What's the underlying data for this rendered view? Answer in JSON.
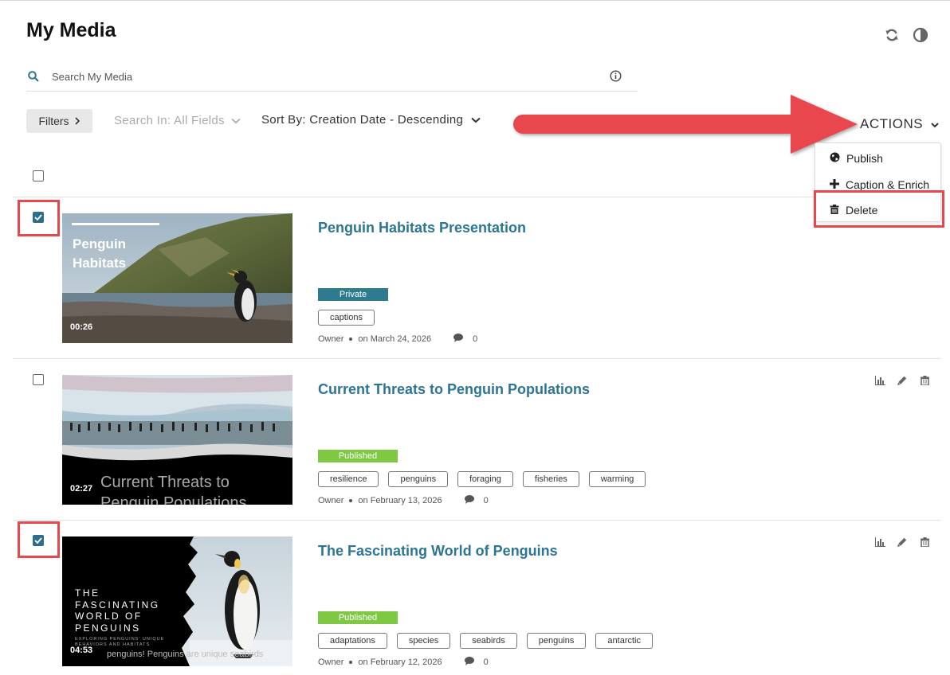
{
  "page": {
    "title": "My Media"
  },
  "search": {
    "placeholder": "Search My Media"
  },
  "toolbar": {
    "filters_label": "Filters",
    "search_in_label": "Search In: All Fields",
    "sort_by_label": "Sort By: Creation Date - Descending",
    "actions_label": "ACTIONS"
  },
  "actions_menu": {
    "items": [
      {
        "label": "Publish",
        "icon": "globe-icon"
      },
      {
        "label": "Caption & Enrich",
        "icon": "plus-icon"
      },
      {
        "label": "Delete",
        "icon": "trash-icon",
        "highlighted": true
      }
    ]
  },
  "colors": {
    "accent": "#2c7594",
    "private": "#2e7b90",
    "published": "#7fc844",
    "highlight": "#e8474d",
    "checkbox_checked": "#2d6e8c"
  },
  "entries": [
    {
      "title": "Penguin Habitats Presentation",
      "checked": true,
      "thumb_text": [
        "Penguin",
        "Habitats"
      ],
      "duration": "00:26",
      "status": "Private",
      "tags": [
        "captions"
      ],
      "owner": "Owner",
      "date": "on March 24, 2026",
      "comments": "0",
      "show_row_actions": false
    },
    {
      "title": "Current Threats to Penguin Populations",
      "checked": false,
      "thumb_text": [
        "Current Threats to",
        "Penguin Populations"
      ],
      "duration": "02:27",
      "status": "Published",
      "tags": [
        "resilience",
        "penguins",
        "foraging",
        "fisheries",
        "warming"
      ],
      "owner": "Owner",
      "date": "on February 13, 2026",
      "comments": "0",
      "show_row_actions": true
    },
    {
      "title": "The Fascinating World of Penguins",
      "checked": true,
      "thumb_text": [
        "THE",
        "FASCINATING",
        "WORLD OF",
        "PENGUINS"
      ],
      "thumb_subtext": [
        "EXPLORING PENGUINS' UNIQUE",
        "BEHAVIORS AND HABITATS"
      ],
      "thumb_caption": "penguins! Penguins are unique seabirds",
      "duration": "04:53",
      "status": "Published",
      "tags": [
        "adaptations",
        "species",
        "seabirds",
        "penguins",
        "antarctic"
      ],
      "owner": "Owner",
      "date": "on February 12, 2026",
      "comments": "0",
      "show_row_actions": true
    }
  ]
}
